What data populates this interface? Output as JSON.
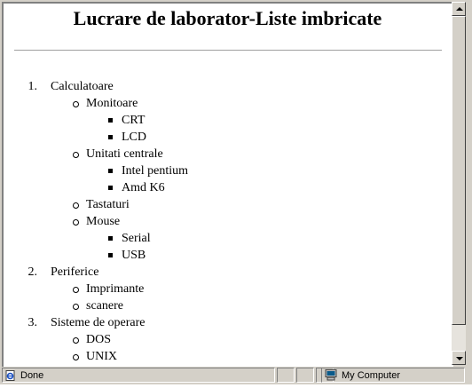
{
  "page": {
    "title": "Lucrare de laborator-Liste imbricate"
  },
  "list": [
    {
      "number": "1.",
      "label": "Calculatoare",
      "children": [
        {
          "label": "Monitoare",
          "children": [
            "CRT",
            "LCD"
          ]
        },
        {
          "label": "Unitati centrale",
          "children": [
            "Intel pentium",
            "Amd K6"
          ]
        },
        {
          "label": "Tastaturi",
          "children": []
        },
        {
          "label": "Mouse",
          "children": [
            "Serial",
            "USB"
          ]
        }
      ]
    },
    {
      "number": "2.",
      "label": "Periferice",
      "children": [
        {
          "label": "Imprimante",
          "children": []
        },
        {
          "label": "scanere",
          "children": []
        }
      ]
    },
    {
      "number": "3.",
      "label": "Sisteme de operare",
      "children": [
        {
          "label": "DOS",
          "children": []
        },
        {
          "label": "UNIX",
          "children": []
        }
      ]
    }
  ],
  "statusbar": {
    "status_text": "Done",
    "zone_text": "My Computer",
    "status_icon": "ie-page-icon",
    "zone_icon": "my-computer-icon"
  }
}
